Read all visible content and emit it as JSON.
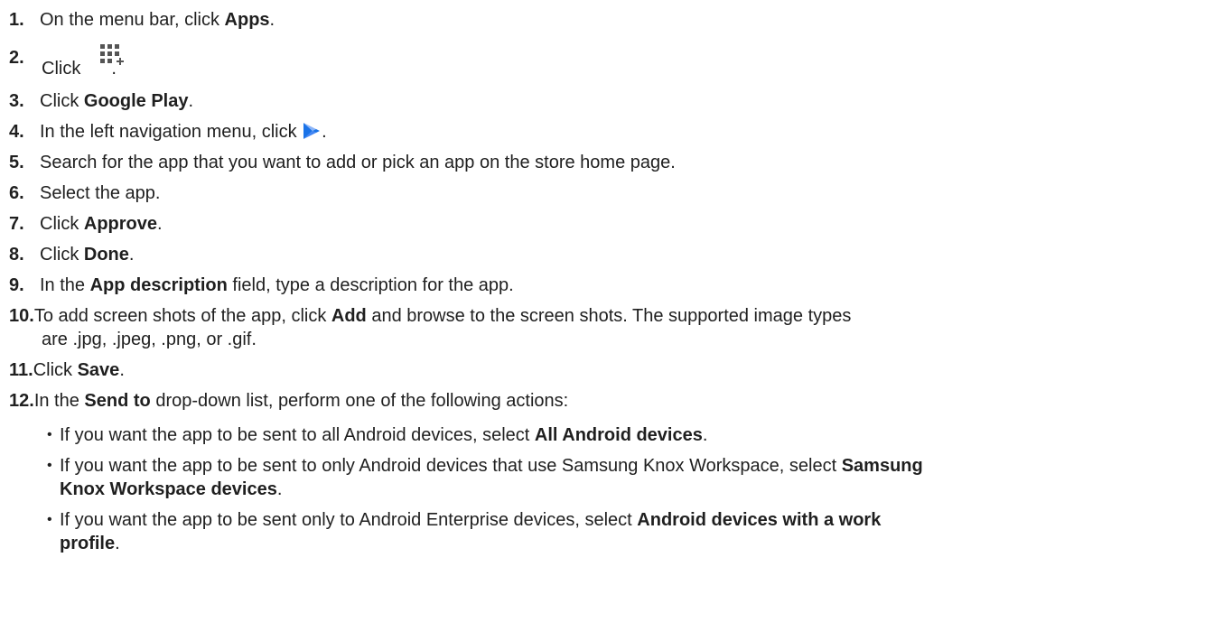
{
  "steps": {
    "s1": {
      "num": "1.",
      "pre": "On the menu bar, click ",
      "bold": "Apps",
      "post": "."
    },
    "s2": {
      "num": "2.",
      "pre": "Click",
      "icon": "add-apps-grid-icon",
      "post": "."
    },
    "s3": {
      "num": "3.",
      "pre": "Click ",
      "bold": "Google Play",
      "post": "."
    },
    "s4": {
      "num": "4.",
      "pre": "In the left navigation menu, click",
      "icon": "google-play-icon",
      "post": "."
    },
    "s5": {
      "num": "5.",
      "text": "Search for the app that you want to add or pick an app on the store home page."
    },
    "s6": {
      "num": "6.",
      "text": "Select the app."
    },
    "s7": {
      "num": "7.",
      "pre": "Click ",
      "bold": "Approve",
      "post": "."
    },
    "s8": {
      "num": "8.",
      "pre": "Click ",
      "bold": "Done",
      "post": "."
    },
    "s9": {
      "num": "9.",
      "pre": "In the ",
      "bold": "App description",
      "post": " field, type a description for the app."
    },
    "s10": {
      "num": "10.",
      "pre": "To add screen shots of the app, click ",
      "bold": "Add",
      "post": " and browse to the screen shots. The supported image types",
      "line2": "are .jpg, .jpeg, .png, or .gif."
    },
    "s11": {
      "num": "11.",
      "pre": "Click ",
      "bold": "Save",
      "post": "."
    },
    "s12": {
      "num": "12.",
      "pre": "In the ",
      "bold": "Send to",
      "post": " drop-down list, perform one of the following actions:"
    }
  },
  "bullets": [
    {
      "pre": "If you want the app to be sent to all Android devices, select ",
      "bold": "All Android devices",
      "post": "."
    },
    {
      "pre": "If you want the app to be sent to only Android devices that use Samsung Knox Workspace, select ",
      "bold": "Samsung",
      "line2_bold": "Knox Workspace devices",
      "line2_post": "."
    },
    {
      "pre": "If you want the app to be sent only to Android Enterprise devices, select ",
      "bold": "Android devices with a work",
      "line2_bold": "profile",
      "line2_post": "."
    }
  ],
  "colors": {
    "text": "#1f1f1f",
    "icon_gray": "#555555",
    "play_blue": "#1a73e8",
    "play_light": "#8ab4f8"
  }
}
